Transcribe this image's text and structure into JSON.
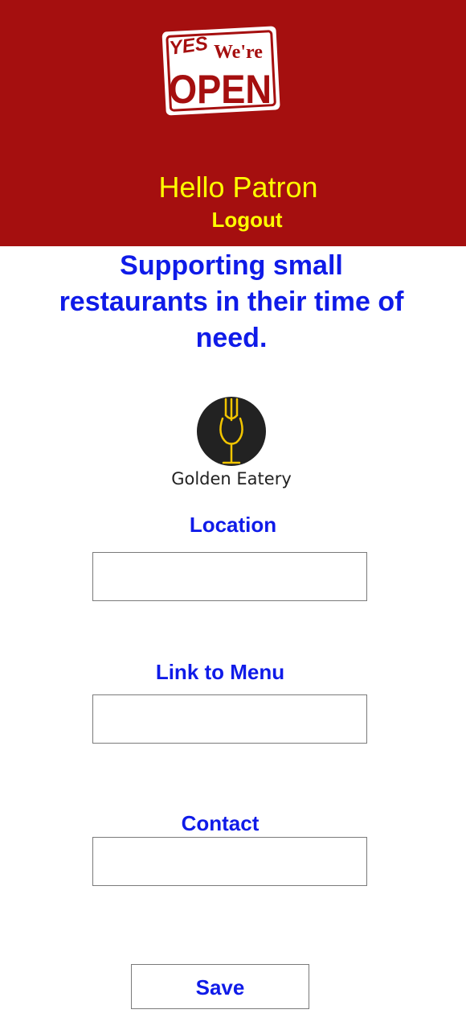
{
  "header": {
    "logo": {
      "yes_text": "YES",
      "were_text": "We're",
      "open_text": "OPEN",
      "icon": "yes-were-open-sign-logo"
    },
    "greeting": "Hello Patron",
    "logout_label": "Logout"
  },
  "tagline": "Supporting small restaurants in their time of need.",
  "restaurant": {
    "name": "Golden Eatery",
    "icon": "fork-wineglass-logo"
  },
  "form": {
    "location": {
      "label": "Location",
      "value": "",
      "placeholder": ""
    },
    "menu_link": {
      "label": "Link to Menu",
      "value": "",
      "placeholder": ""
    },
    "contact": {
      "label": "Contact",
      "value": "",
      "placeholder": ""
    },
    "save_label": "Save"
  },
  "colors": {
    "header_bg": "#a50f0f",
    "header_text": "#ffff00",
    "accent_blue": "#0f1be8",
    "logo_gold": "#f2c500",
    "logo_dark": "#222222"
  }
}
